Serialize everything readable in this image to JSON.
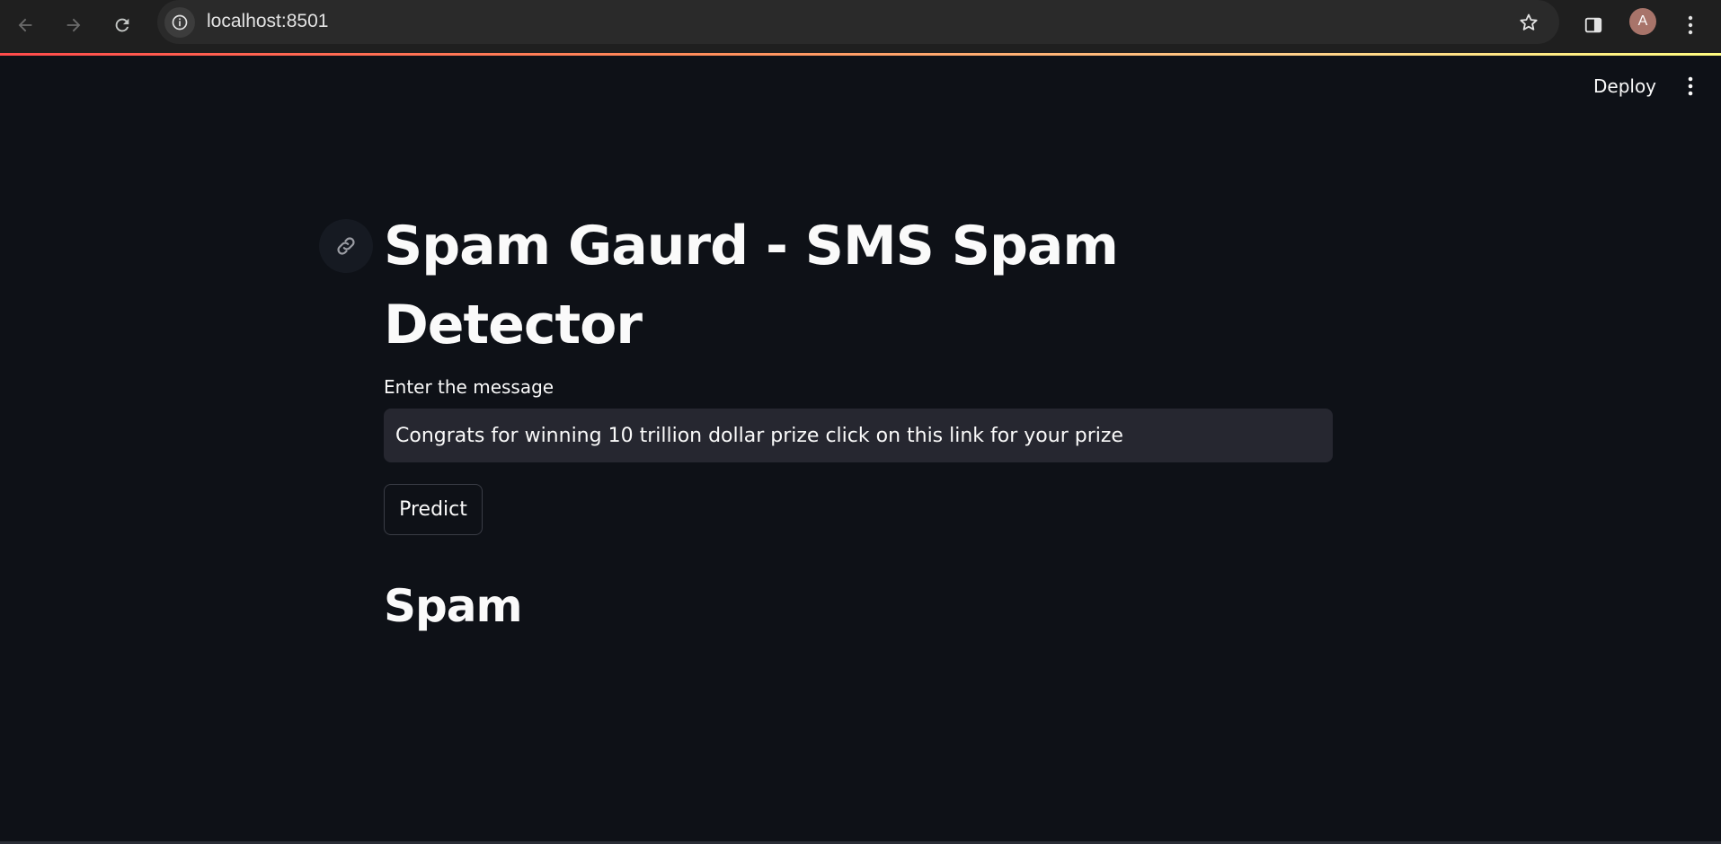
{
  "browser": {
    "url": "localhost:8501",
    "profile_initial": "A",
    "icons": {
      "back": "back-arrow-icon",
      "forward": "forward-arrow-icon",
      "reload": "reload-icon",
      "site_info": "info-icon",
      "bookmark": "star-icon",
      "side_panel": "side-panel-icon",
      "menu": "vertical-dots-icon"
    }
  },
  "app_header": {
    "deploy_label": "Deploy",
    "menu_icon": "vertical-dots-icon"
  },
  "main": {
    "title": "Spam Gaurd - SMS Spam Detector",
    "anchor_icon": "link-icon",
    "input_label": "Enter the message",
    "input_value": "Congrats for winning 10 trillion dollar prize click on this link for your prize",
    "predict_label": "Predict",
    "result": "Spam"
  },
  "colors": {
    "background": "#0e1117",
    "input_bg": "#262730",
    "text": "#fafafa",
    "accent": "#ff4b4b"
  }
}
